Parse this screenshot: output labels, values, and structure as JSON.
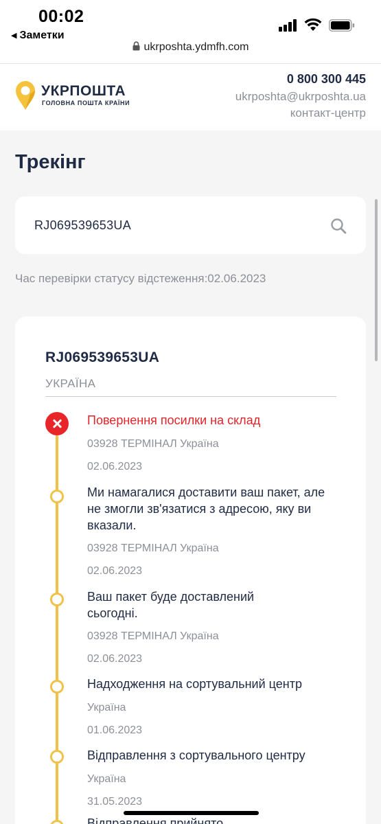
{
  "status_bar": {
    "time": "00:02",
    "back_app": "Заметки",
    "icons": [
      "signal-icon",
      "wifi-icon",
      "battery-icon"
    ]
  },
  "browser": {
    "url": "ukrposhta.ydmfh.com"
  },
  "header": {
    "brand_name": "УКРПОШТА",
    "brand_tagline": "ГОЛОВНА ПОШТА КРАЇНИ",
    "phone": "0 800 300 445",
    "email": "ukrposhta@ukrposhta.ua",
    "contact": "контакт-центр"
  },
  "page": {
    "title": "Трекінг",
    "search_value": "RJ069539653UA",
    "check_time": "Час перевірки статусу відстеження:02.06.2023"
  },
  "tracking": {
    "number": "RJ069539653UA",
    "country": "УКРАЇНА",
    "events": [
      {
        "title": "Повернення посилки на склад",
        "location": "03928 ТЕРМІНАЛ Україна",
        "date": "02.06.2023",
        "status": "error"
      },
      {
        "title": "Ми намагалися доставити ваш пакет, але не змогли зв'язатися з адресою, яку ви вказали.",
        "location": "03928 ТЕРМІНАЛ Україна",
        "date": "02.06.2023",
        "status": "normal"
      },
      {
        "title": "Ваш пакет буде доставлений сьогодні.",
        "location": "03928 ТЕРМІНАЛ Україна",
        "date": "02.06.2023",
        "status": "normal"
      },
      {
        "title": "Надходження на сортувальний центр",
        "location": "Україна",
        "date": "01.06.2023",
        "status": "normal"
      },
      {
        "title": "Відправлення з сортувального центру",
        "location": "Україна",
        "date": "31.05.2023",
        "status": "normal"
      }
    ],
    "partial_next_title": "Відправлення прийнято"
  },
  "colors": {
    "brand_yellow": "#f1c24a",
    "brand_navy": "#1f2a44",
    "error_red": "#e0242a",
    "muted_gray": "#8d8f98"
  }
}
